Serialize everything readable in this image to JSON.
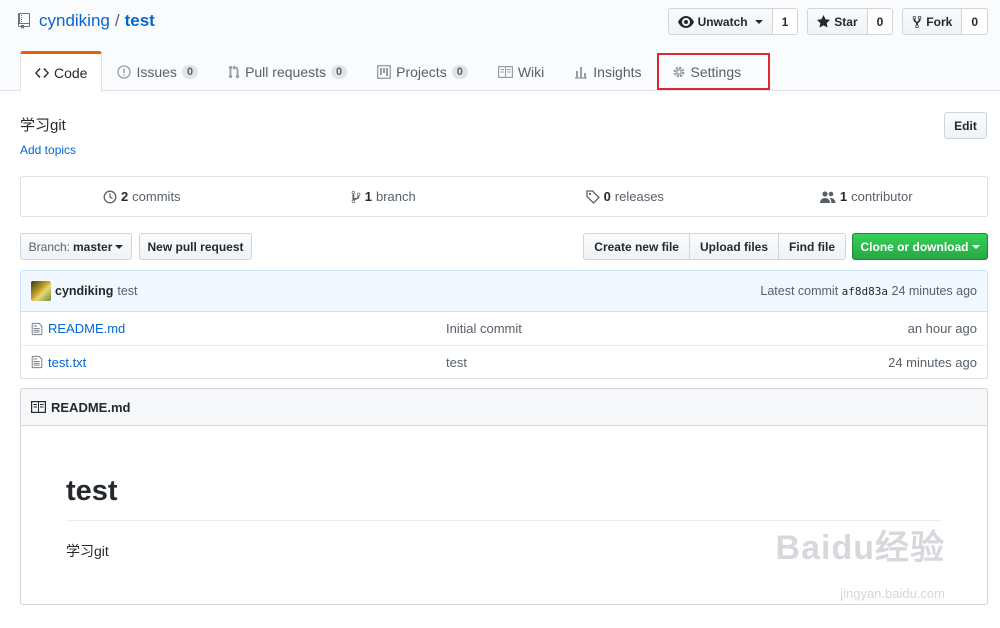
{
  "repo": {
    "owner": "cyndiking",
    "separator": "/",
    "name": "test"
  },
  "actions": {
    "watch": {
      "label": "Unwatch",
      "count": "1"
    },
    "star": {
      "label": "Star",
      "count": "0"
    },
    "fork": {
      "label": "Fork",
      "count": "0"
    }
  },
  "tabs": [
    {
      "label": "Code",
      "icon": "code-icon",
      "selected": true
    },
    {
      "label": "Issues",
      "count": "0",
      "icon": "issue-icon"
    },
    {
      "label": "Pull requests",
      "count": "0",
      "icon": "pull-request-icon"
    },
    {
      "label": "Projects",
      "count": "0",
      "icon": "project-icon"
    },
    {
      "label": "Wiki",
      "icon": "book-icon"
    },
    {
      "label": "Insights",
      "icon": "graph-icon"
    },
    {
      "label": "Settings",
      "icon": "gear-icon"
    }
  ],
  "description": "学习git",
  "add_topics": "Add topics",
  "edit_label": "Edit",
  "summary": {
    "commits": {
      "num": "2",
      "label": "commits"
    },
    "branches": {
      "num": "1",
      "label": "branch"
    },
    "releases": {
      "num": "0",
      "label": "releases"
    },
    "contributors": {
      "num": "1",
      "label": "contributor"
    }
  },
  "filebar": {
    "branch_prefix": "Branch:",
    "branch": "master",
    "new_pr": "New pull request",
    "create_file": "Create new file",
    "upload_files": "Upload files",
    "find_file": "Find file",
    "clone": "Clone or download"
  },
  "commit": {
    "author": "cyndiking",
    "message": "test",
    "latest_label": "Latest commit",
    "sha": "af8d83a",
    "time": "24 minutes ago"
  },
  "files": [
    {
      "name": "README.md",
      "message": "Initial commit",
      "age": "an hour ago"
    },
    {
      "name": "test.txt",
      "message": "test",
      "age": "24 minutes ago"
    }
  ],
  "readme": {
    "filename": "README.md",
    "heading": "test",
    "body": "学习git"
  },
  "watermark": {
    "main": "Baidu经验",
    "sub": "jingyan.baidu.com"
  },
  "colors": {
    "accent_tab": "#e36209",
    "link": "#0366d6",
    "clone_green": "#28a745",
    "highlight": "#e0272e"
  }
}
